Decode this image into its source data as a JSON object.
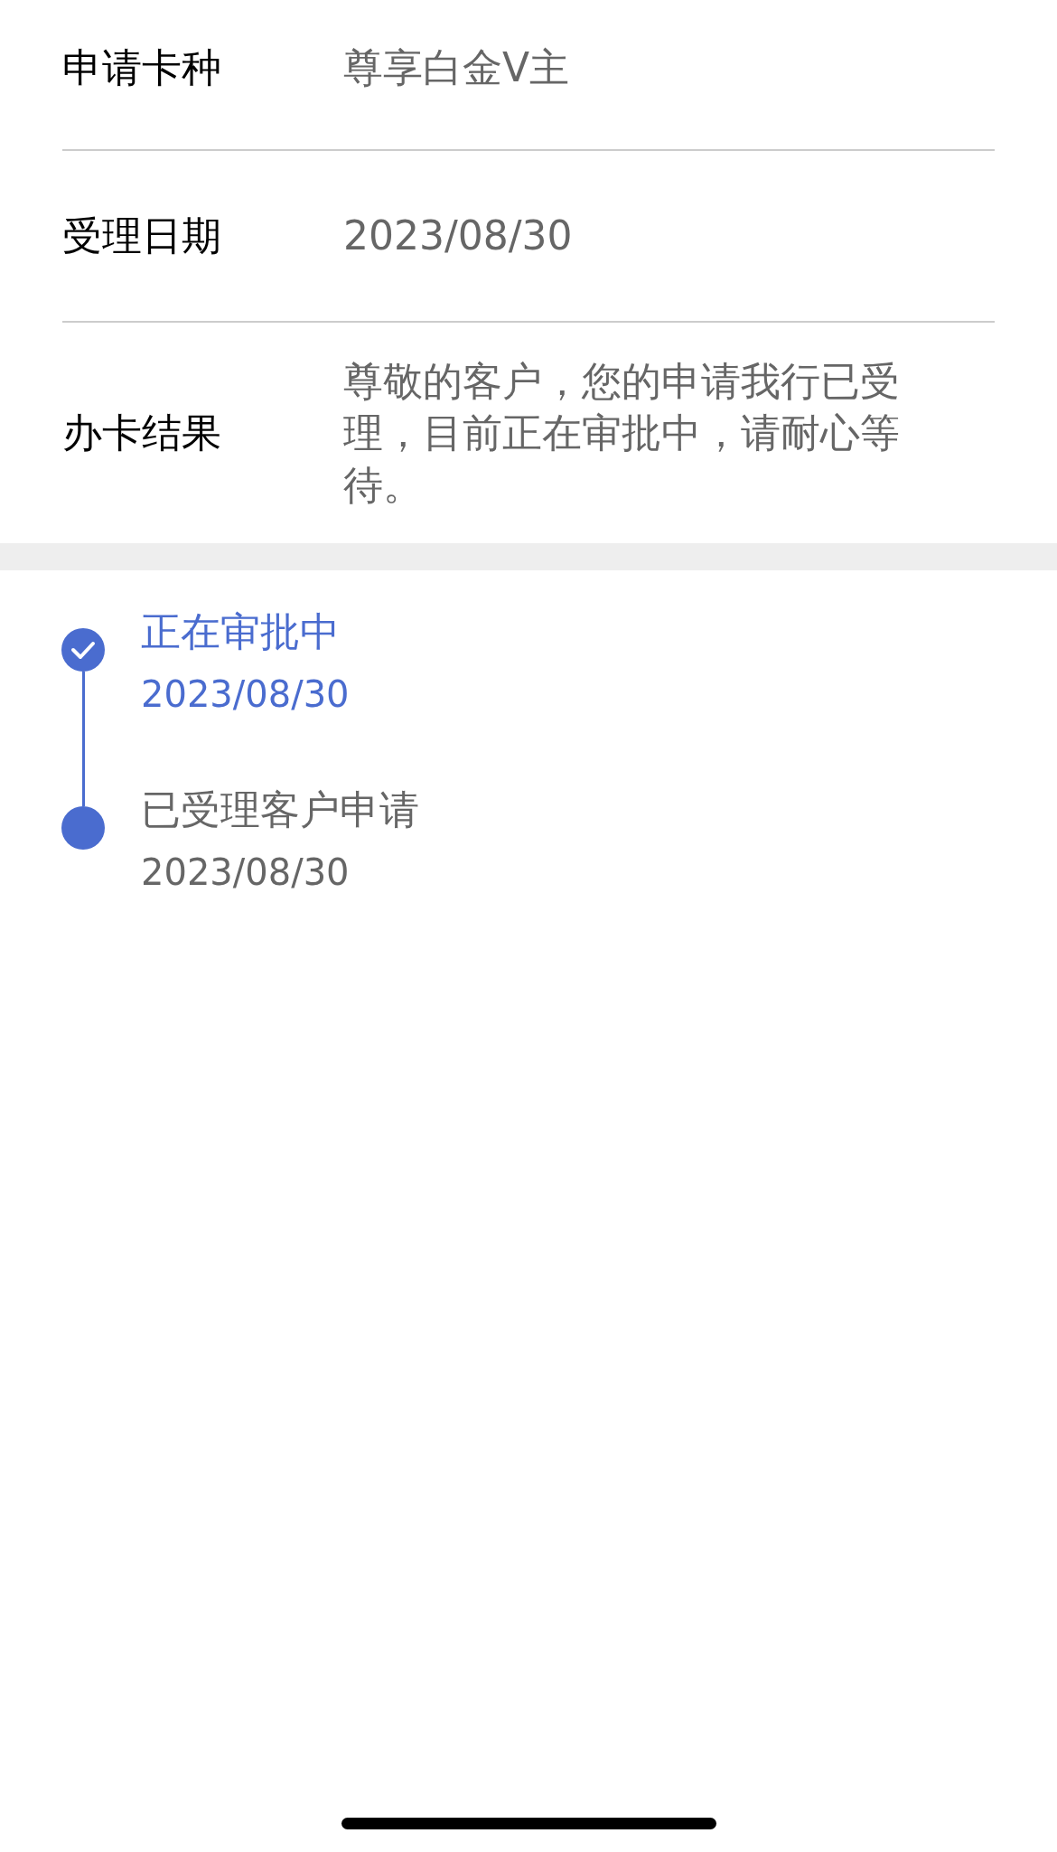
{
  "details": [
    {
      "label": "申请卡种",
      "value": "尊享白金V主"
    },
    {
      "label": "受理日期",
      "value": "2023/08/30"
    },
    {
      "label": "办卡结果",
      "value": "尊敬的客户，您的申请我行已受理，目前正在审批中，请耐心等待。"
    }
  ],
  "timeline": [
    {
      "title": "正在审批中",
      "date": "2023/08/30",
      "current": true
    },
    {
      "title": "已受理客户申请",
      "date": "2023/08/30",
      "current": false
    }
  ]
}
